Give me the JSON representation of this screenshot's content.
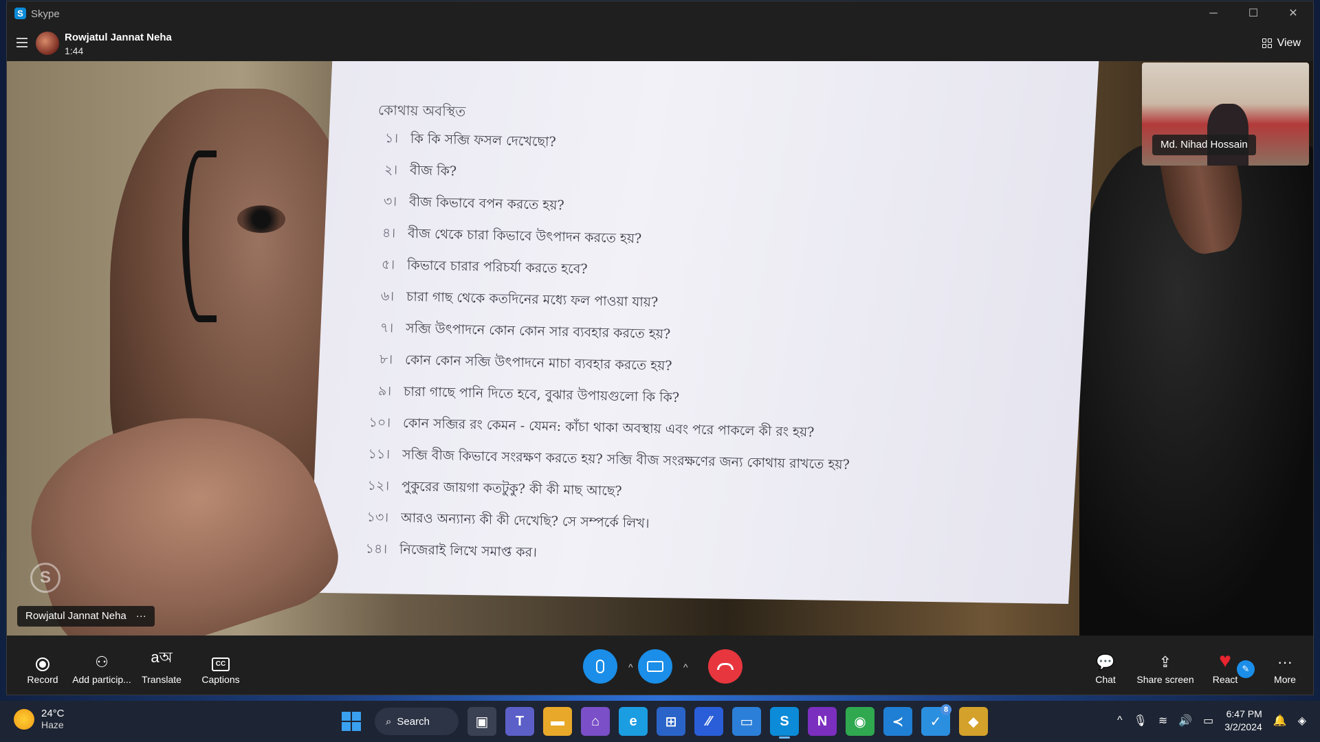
{
  "window": {
    "app_name": "Skype",
    "minimize": "─",
    "maximize": "☐",
    "close": "✕"
  },
  "call": {
    "caller_name": "Rowjatul Jannat Neha",
    "duration": "1:44",
    "view_label": "View"
  },
  "paper": {
    "heading": "কোথায় অবস্থিত",
    "questions": [
      {
        "num": "১।",
        "text": "কি কি সব্জি ফসল দেখেছো?"
      },
      {
        "num": "২।",
        "text": "বীজ কি?"
      },
      {
        "num": "৩।",
        "text": "বীজ কিভাবে বপন করতে হয়?"
      },
      {
        "num": "৪।",
        "text": "বীজ থেকে চারা কিভাবে উৎপাদন করতে হয়?"
      },
      {
        "num": "৫।",
        "text": "কিভাবে চারার পরিচর্যা করতে হবে?"
      },
      {
        "num": "৬।",
        "text": "চারা গাছ থেকে কতদিনের মধ্যে ফল পাওয়া যায়?"
      },
      {
        "num": "৭।",
        "text": "সব্জি উৎপাদনে কোন কোন সার ব্যবহার করতে হয়?"
      },
      {
        "num": "৮।",
        "text": "কোন কোন সব্জি উৎপাদনে মাচা ব্যবহার করতে হয়?"
      },
      {
        "num": "৯।",
        "text": "চারা গাছে পানি দিতে হবে, বুঝার উপায়গুলো কি কি?"
      },
      {
        "num": "১০।",
        "text": "কোন সব্জির রং কেমন - যেমন: কাঁচা থাকা অবস্থায় এবং পরে পাকলে কী রং হয়?"
      },
      {
        "num": "১১।",
        "text": "সব্জি বীজ কিভাবে সংরক্ষণ করতে হয়? সব্জি বীজ সংরক্ষণের জন্য কোথায় রাখতে হয়?"
      },
      {
        "num": "১২।",
        "text": "পুকুরের জায়গা কতটুকু? কী কী মাছ আছে?"
      },
      {
        "num": "১৩।",
        "text": "আরও অন্যান্য কী কী দেখেছি? সে সম্পর্কে লিখ।"
      },
      {
        "num": "১৪।",
        "text": "নিজেরাই লিখে সমাপ্ত কর।"
      }
    ]
  },
  "participants": {
    "main_name": "Rowjatul Jannat Neha",
    "main_more": "···",
    "pip_name": "Md. Nihad Hossain"
  },
  "controls": {
    "record": "Record",
    "add_participant": "Add particip...",
    "translate": "Translate",
    "translate_glyph": "aঅ",
    "captions": "Captions",
    "captions_glyph": "CC",
    "chat": "Chat",
    "share_screen": "Share screen",
    "react": "React",
    "more": "More",
    "caret": "^"
  },
  "taskbar": {
    "temperature": "24°C",
    "weather": "Haze",
    "search_label": "Search",
    "time": "6:47 PM",
    "date": "3/2/2024",
    "apps": [
      {
        "name": "task-view-icon",
        "glyph": "▣",
        "color": "#3a4152"
      },
      {
        "name": "teams-icon",
        "glyph": "T",
        "color": "#5b5fc7"
      },
      {
        "name": "file-explorer-icon",
        "glyph": "▬",
        "color": "#e8a92a"
      },
      {
        "name": "preview-app-icon",
        "glyph": "⌂",
        "color": "#7a4fc8"
      },
      {
        "name": "edge-icon",
        "glyph": "e",
        "color": "#1b9de2"
      },
      {
        "name": "microsoft-store-icon",
        "glyph": "⊞",
        "color": "#2a64c8"
      },
      {
        "name": "whiteboard-icon",
        "glyph": "∕∕",
        "color": "#2a5ed8"
      },
      {
        "name": "remote-desktop-icon",
        "glyph": "▭",
        "color": "#2b7fd8"
      },
      {
        "name": "skype-icon",
        "glyph": "S",
        "color": "#0b8bd8"
      },
      {
        "name": "onenote-icon",
        "glyph": "N",
        "color": "#7b2fbf"
      },
      {
        "name": "chrome-icon",
        "glyph": "◉",
        "color": "#2fa84f"
      },
      {
        "name": "vscode-icon",
        "glyph": "≺",
        "color": "#1f7fd4"
      },
      {
        "name": "tools-icon",
        "glyph": "✓",
        "color": "#2b8fe0"
      },
      {
        "name": "git-icon",
        "glyph": "◆",
        "color": "#d4a12a"
      }
    ],
    "tools_badge": "8",
    "tray_chevron": "^",
    "tray_mic": "🎙",
    "tray_wifi": "≋",
    "tray_volume": "🔊",
    "tray_battery": "▭",
    "tray_bell": "🔔",
    "tray_copilot": "◈"
  }
}
